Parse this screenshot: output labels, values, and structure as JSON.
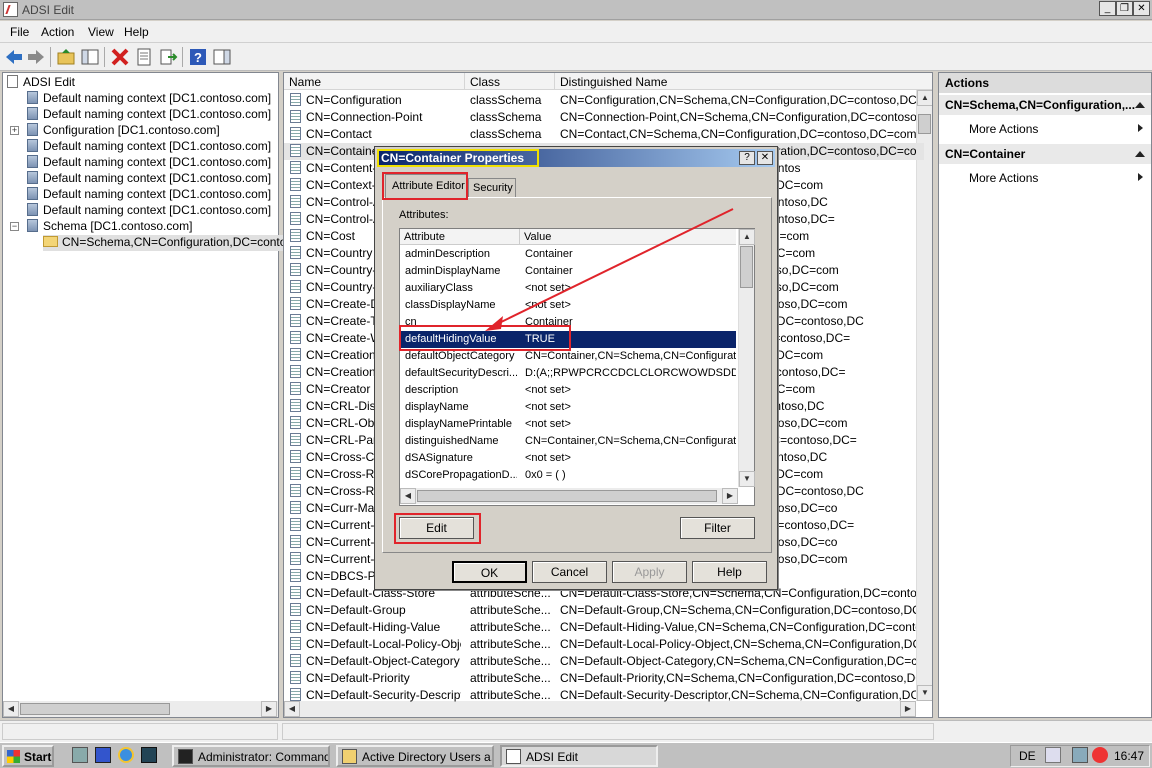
{
  "window": {
    "title": "ADSI Edit"
  },
  "menu": [
    "File",
    "Action",
    "View",
    "Help"
  ],
  "toolbar_icons": [
    "back-icon",
    "forward-icon",
    "up-folder-icon",
    "show-hide-tree-icon",
    "delete-icon",
    "properties-icon",
    "export-icon",
    "help-icon",
    "show-action-pane-icon"
  ],
  "tree": {
    "root": "ADSI Edit",
    "items": [
      {
        "label": "Default naming context [DC1.contoso.com]",
        "indent": 1
      },
      {
        "label": "Default naming context [DC1.contoso.com]",
        "indent": 1
      },
      {
        "label": "Configuration [DC1.contoso.com]",
        "indent": 1,
        "expander": "+"
      },
      {
        "label": "Default naming context [DC1.contoso.com]",
        "indent": 1
      },
      {
        "label": "Default naming context [DC1.contoso.com]",
        "indent": 1
      },
      {
        "label": "Default naming context [DC1.contoso.com]",
        "indent": 1
      },
      {
        "label": "Default naming context [DC1.contoso.com]",
        "indent": 1
      },
      {
        "label": "Default naming context [DC1.contoso.com]",
        "indent": 1
      },
      {
        "label": "Schema [DC1.contoso.com]",
        "indent": 1,
        "expander": "−"
      },
      {
        "label": "CN=Schema,CN=Configuration,DC=contoso",
        "indent": 2,
        "selected": true,
        "folder": true
      }
    ]
  },
  "list": {
    "headers": [
      "Name",
      "Class",
      "Distinguished Name"
    ],
    "rows": [
      [
        "CN=Configuration",
        "classSchema",
        "CN=Configuration,CN=Schema,CN=Configuration,DC=contoso,DC=com"
      ],
      [
        "CN=Connection-Point",
        "classSchema",
        "CN=Connection-Point,CN=Schema,CN=Configuration,DC=contoso,DC=com"
      ],
      [
        "CN=Contact",
        "classSchema",
        "CN=Contact,CN=Schema,CN=Configuration,DC=contoso,DC=com"
      ],
      [
        "CN=Container",
        "classSchema",
        "CN=Container,CN=Schema,CN=Configuration,DC=contoso,DC=com"
      ],
      [
        "CN=Content-I",
        "",
        "n,CN=Schema,CN=Configuration,DC=contos"
      ],
      [
        "CN=Context-M",
        "",
        "Schema,CN=Configuration,DC=contoso,DC=com"
      ],
      [
        "CN=Control-A",
        "",
        "a,CN=Schema,CN=Configuration,DC=contoso,DC"
      ],
      [
        "CN=Control-A",
        "",
        "n,CN=Schema,CN=Configuration,DC=contoso,DC="
      ],
      [
        "CN=Cost",
        "",
        "hema,CN=Configuration,DC=contoso,DC=com"
      ],
      [
        "CN=Country",
        "",
        "chema,CN=Configuration,DC=contoso,DC=com"
      ],
      [
        "CN=Country-C",
        "",
        "N=Schema,CN=Configuration,DC=contoso,DC=com"
      ],
      [
        "CN=Country-N",
        "",
        "N=Schema,CN=Configuration,DC=contoso,DC=com"
      ],
      [
        "CN=Create-Di",
        "",
        "CN=Schema,CN=Configuration,DC=contoso,DC=com"
      ],
      [
        "CN=Create-Ti",
        "",
        "ontainer,CN=Schema,CN=Configuration,DC=contoso,DC"
      ],
      [
        "CN=Create-W",
        "",
        "ects,CN=Schema,CN=Configuration,DC=contoso,DC="
      ],
      [
        "CN=Creation-",
        "",
        "Schema,CN=Configuration,DC=contoso,DC=com"
      ],
      [
        "CN=Creation-",
        "",
        "ard,CN=Schema,CN=Configuration,DC=contoso,DC="
      ],
      [
        "CN=Creator",
        "",
        "chema,CN=Configuration,DC=contoso,DC=com"
      ],
      [
        "CN=CRL-Distri",
        "",
        "t,CN=Schema,CN=Configuration,DC=contoso,DC"
      ],
      [
        "CN=CRL-Obje",
        "",
        "CN=Schema,CN=Configuration,DC=contoso,DC=com"
      ],
      [
        "CN=CRL-Parti",
        "",
        "n-Set,CN=Schema,CN=Configuration,DC=contoso,DC="
      ],
      [
        "CN=Cross-Cer",
        "",
        "ir,CN=Schema,CN=Configuration,DC=contoso,DC"
      ],
      [
        "CN=Cross-Ref",
        "",
        "Schema,CN=Configuration,DC=contoso,DC=com"
      ],
      [
        "CN=Cross-Ref",
        "",
        "ontainer,CN=Schema,CN=Configuration,DC=contoso,DC"
      ],
      [
        "CN=Curr-Mach",
        "",
        "CN=Schema,CN=Configuration,DC=contoso,DC=co"
      ],
      [
        "CN=Current-L",
        "",
        "ation,CN=Schema,CN=Configuration,DC=contoso,DC="
      ],
      [
        "CN=Current-P",
        "",
        "CN=Schema,CN=Configuration,DC=contoso,DC=co"
      ],
      [
        "CN=Current-V",
        "",
        "CN=Schema,CN=Configuration,DC=contoso,DC=com"
      ],
      [
        "CN=DBCS-Pwd",
        "",
        "on,DC=contoso,DC=com"
      ],
      [
        "CN=Default-Class-Store",
        "attributeSche...",
        "CN=Default-Class-Store,CN=Schema,CN=Configuration,DC=contoso,DC=co"
      ],
      [
        "CN=Default-Group",
        "attributeSche...",
        "CN=Default-Group,CN=Schema,CN=Configuration,DC=contoso,DC=com"
      ],
      [
        "CN=Default-Hiding-Value",
        "attributeSche...",
        "CN=Default-Hiding-Value,CN=Schema,CN=Configuration,DC=contoso,DC="
      ],
      [
        "CN=Default-Local-Policy-Object",
        "attributeSche...",
        "CN=Default-Local-Policy-Object,CN=Schema,CN=Configuration,DC=contoso"
      ],
      [
        "CN=Default-Object-Category",
        "attributeSche...",
        "CN=Default-Object-Category,CN=Schema,CN=Configuration,DC=contoso"
      ],
      [
        "CN=Default-Priority",
        "attributeSche...",
        "CN=Default-Priority,CN=Schema,CN=Configuration,DC=contoso,DC=com"
      ],
      [
        "CN=Default-Security-Descriptor",
        "attributeSche...",
        "CN=Default-Security-Descriptor,CN=Schema,CN=Configuration,DC=conto"
      ]
    ]
  },
  "actions": {
    "header": "Actions",
    "sections": [
      {
        "title": "CN=Schema,CN=Configuration,...",
        "item": "More Actions"
      },
      {
        "title": "CN=Container",
        "item": "More Actions"
      }
    ]
  },
  "dialog": {
    "title": "CN=Container Properties",
    "tabs": [
      "Attribute Editor",
      "Security"
    ],
    "attributes_label": "Attributes:",
    "columns": [
      "Attribute",
      "Value"
    ],
    "rows": [
      [
        "adminDescription",
        "Container"
      ],
      [
        "adminDisplayName",
        "Container"
      ],
      [
        "auxiliaryClass",
        "<not set>"
      ],
      [
        "classDisplayName",
        "<not set>"
      ],
      [
        "cn",
        "Container"
      ],
      [
        "defaultHidingValue",
        "TRUE"
      ],
      [
        "defaultObjectCategory",
        "CN=Container,CN=Schema,CN=Configuration"
      ],
      [
        "defaultSecurityDescri...",
        "D:(A;;RPWPCRCCDCLCLORCWOWDSDDT"
      ],
      [
        "description",
        "<not set>"
      ],
      [
        "displayName",
        "<not set>"
      ],
      [
        "displayNamePrintable",
        "<not set>"
      ],
      [
        "distinguishedName",
        "CN=Container,CN=Schema,CN=Configuration"
      ],
      [
        "dSASignature",
        "<not set>"
      ],
      [
        "dSCorePropagationD...",
        "0x0 = ( )"
      ]
    ],
    "selected_row": 5,
    "edit_label": "Edit",
    "filter_label": "Filter",
    "buttons": [
      "OK",
      "Cancel",
      "Apply",
      "Help"
    ]
  },
  "taskbar": {
    "start": "Start",
    "tasks": [
      "Administrator: Command...",
      "Active Directory Users a...",
      "ADSI Edit"
    ],
    "lang": "DE",
    "clock": "16:47"
  }
}
